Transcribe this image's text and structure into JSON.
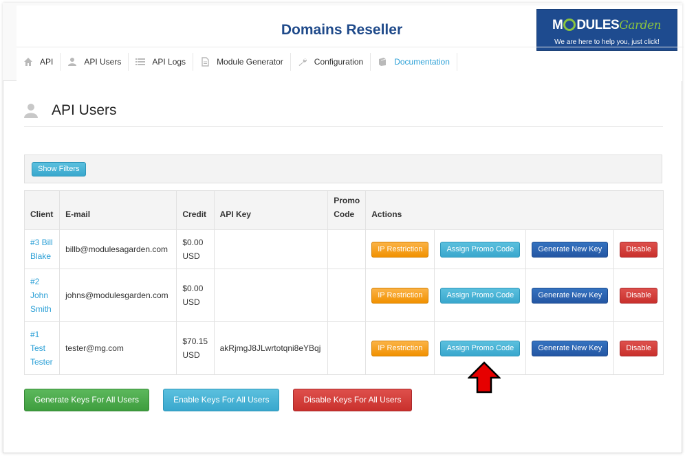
{
  "header": {
    "title": "Domains Reseller",
    "logo": {
      "main_text": "M",
      "main_text_rest": "DULES",
      "garden_text": "Garden",
      "tagline": "We are here to help you, just click!",
      "brand_color": "#1e4b8f",
      "accent_color": "#8bc43f"
    }
  },
  "nav": {
    "items": [
      {
        "label": "API",
        "icon": "home-icon"
      },
      {
        "label": "API Users",
        "icon": "user-icon"
      },
      {
        "label": "API Logs",
        "icon": "list-icon"
      },
      {
        "label": "Module Generator",
        "icon": "file-icon"
      },
      {
        "label": "Configuration",
        "icon": "wrench-icon"
      },
      {
        "label": "Documentation",
        "icon": "book-icon",
        "active": true
      }
    ]
  },
  "page": {
    "title": "API Users",
    "show_filters_label": "Show Filters"
  },
  "table": {
    "headers": {
      "client": "Client",
      "email": "E-mail",
      "credit": "Credit",
      "api_key": "API Key",
      "promo_code_1": "Promo",
      "promo_code_2": "Code",
      "actions": "Actions"
    },
    "rows": [
      {
        "client": "#3 Bill Blake",
        "email": "billb@modulesagarden.com",
        "credit_amount": "$0.00",
        "credit_currency": "USD",
        "api_key": "",
        "promo_code": ""
      },
      {
        "client": "#2 John Smith",
        "email": "johns@modulesgarden.com",
        "credit_amount": "$0.00",
        "credit_currency": "USD",
        "api_key": "",
        "promo_code": ""
      },
      {
        "client": "#1 Test Tester",
        "email": "tester@mg.com",
        "credit_amount": "$70.15",
        "credit_currency": "USD",
        "api_key": "akRjmgJ8JLwrtotqni8eYBqj",
        "promo_code": ""
      }
    ],
    "actions": {
      "ip_restriction": "IP Restriction",
      "assign_promo": "Assign Promo Code",
      "generate_key": "Generate New Key",
      "disable": "Disable"
    }
  },
  "bottom_buttons": {
    "generate_all": "Generate Keys For All Users",
    "enable_all": "Enable Keys For All Users",
    "disable_all": "Disable Keys For All Users"
  },
  "colors": {
    "link": "#2a9fd6",
    "title": "#1f4a8a",
    "annotation_arrow": "#e60000"
  }
}
